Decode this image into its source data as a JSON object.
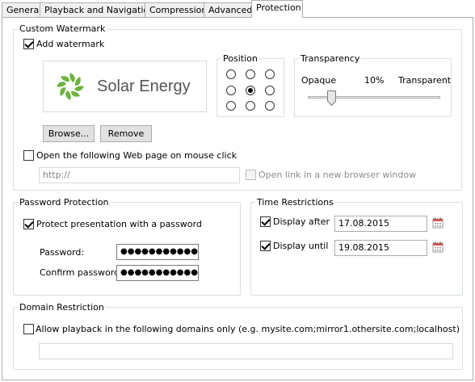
{
  "tabs": [
    {
      "label": "General"
    },
    {
      "label": "Playback and Navigation"
    },
    {
      "label": "Compression"
    },
    {
      "label": "Advanced"
    },
    {
      "label": "Protection",
      "active": true
    }
  ],
  "watermark": {
    "group_title": "Custom Watermark",
    "add_label": "Add watermark",
    "add_checked": true,
    "logo_text": "Solar Energy",
    "logo_color": "#6cb33f",
    "position_title": "Position",
    "position_selected": "center",
    "transparency_title": "Transparency",
    "opaque_label": "Opaque",
    "transparency_value": "10%",
    "transparency_level": 0.1,
    "transparent_label": "Transparent",
    "browse_label": "Browse...",
    "remove_label": "Remove",
    "open_page_label": "Open the following Web page on mouse click",
    "open_page_checked": false,
    "url_value": "http://",
    "new_window_label": "Open link in a new browser window"
  },
  "password": {
    "group_title": "Password Protection",
    "protect_label": "Protect presentation with a password",
    "protect_checked": true,
    "password_label": "Password:",
    "password_value": "●●●●●●●●●●●●",
    "confirm_label": "Confirm password:",
    "confirm_value": "●●●●●●●●●●●●"
  },
  "time": {
    "group_title": "Time Restrictions",
    "after_label": "Display after",
    "after_checked": true,
    "after_value": "17.08.2015",
    "until_label": "Display until",
    "until_checked": true,
    "until_value": "19.08.2015"
  },
  "domain": {
    "group_title": "Domain Restriction",
    "allow_label": "Allow playback in the following domains only (e.g. mysite.com;mirror1.othersite.com;localhost)",
    "allow_checked": false,
    "domains_value": ""
  },
  "colors": {
    "group_border": "#d5dfe5",
    "tab_border": "#adadad",
    "calendar_red": "#d9534f"
  }
}
